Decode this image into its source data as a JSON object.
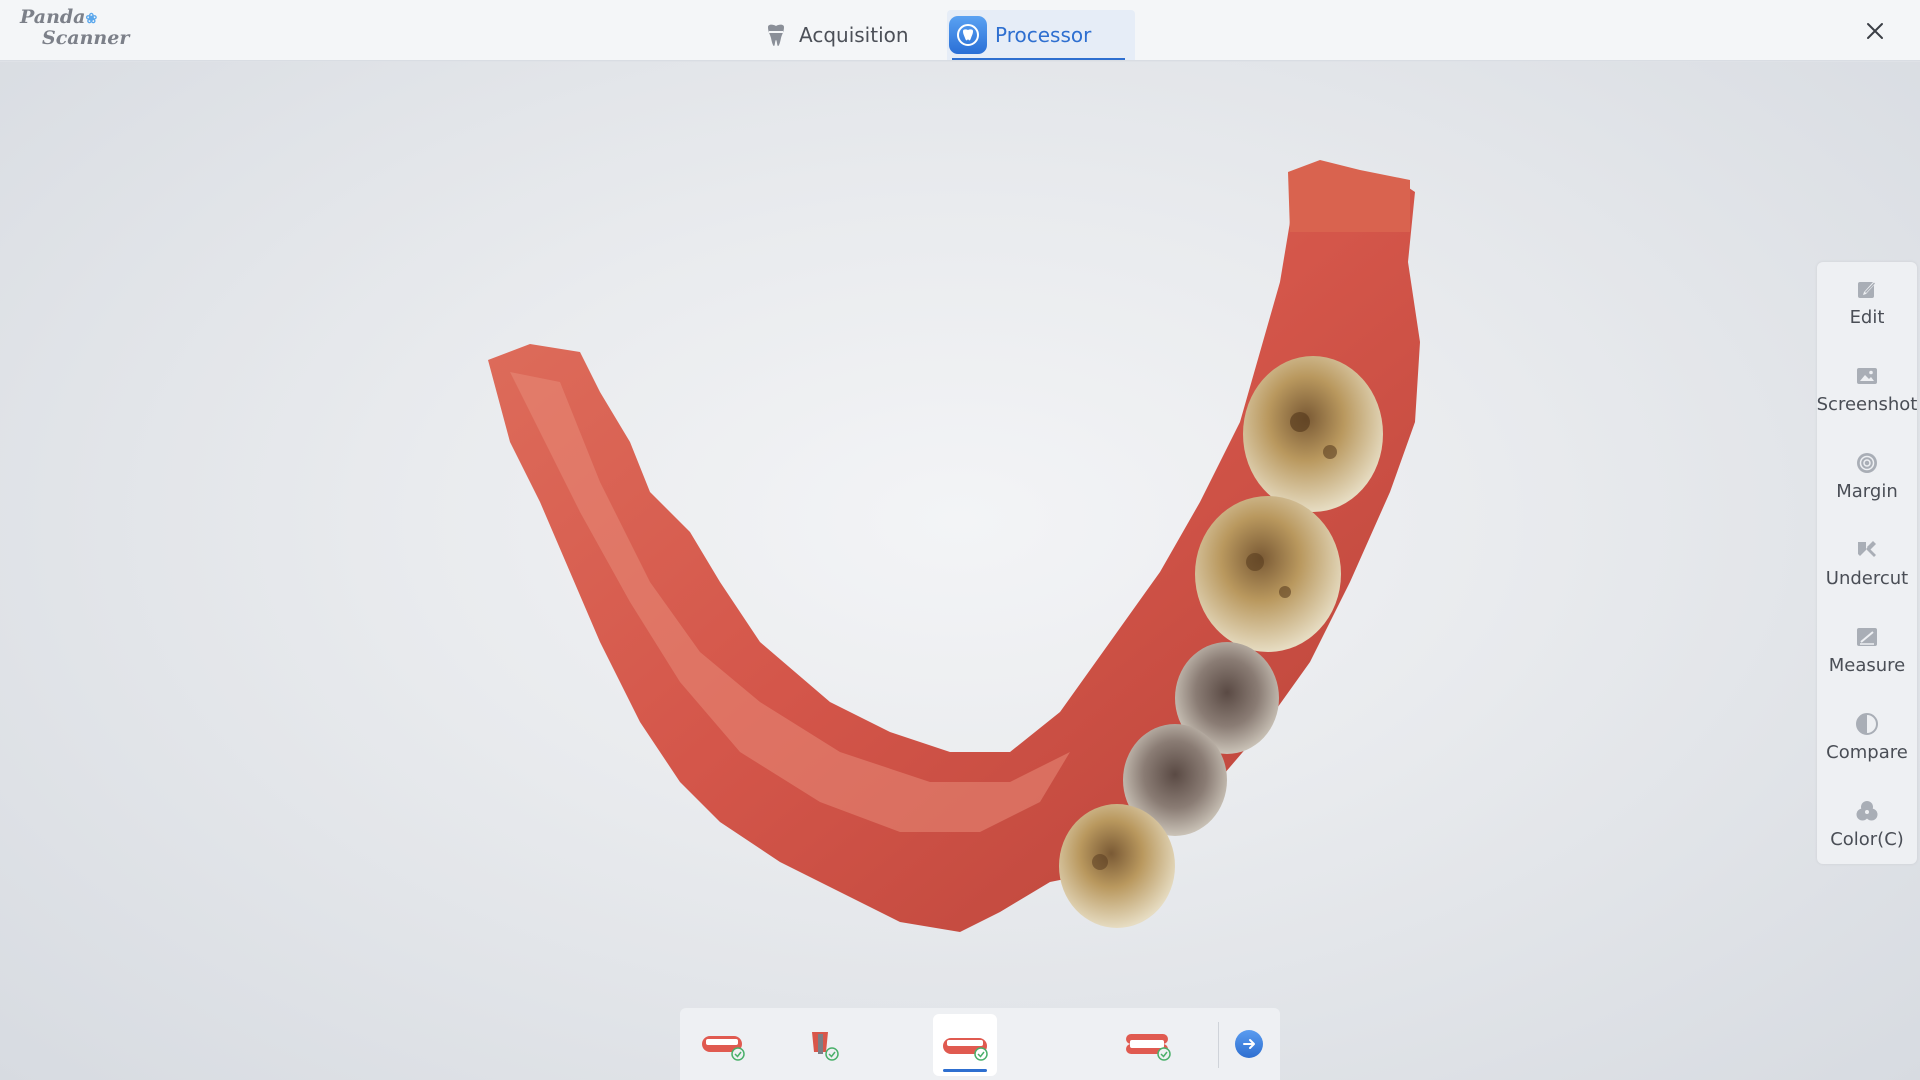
{
  "app": {
    "logo_line1": "Panda",
    "logo_line2": "Scanner"
  },
  "tabs": [
    {
      "label": "Acquisition",
      "icon": "tooth-icon",
      "active": false
    },
    {
      "label": "Processor",
      "icon": "processor-icon",
      "active": true
    }
  ],
  "tools": [
    {
      "label": "Edit",
      "icon": "edit-icon"
    },
    {
      "label": "Screenshot",
      "icon": "screenshot-icon"
    },
    {
      "label": "Margin",
      "icon": "margin-icon"
    },
    {
      "label": "Undercut",
      "icon": "undercut-icon"
    },
    {
      "label": "Measure",
      "icon": "measure-icon"
    },
    {
      "label": "Compare",
      "icon": "compare-icon"
    },
    {
      "label": "Color(C)",
      "icon": "color-icon"
    }
  ],
  "bottom_bar": {
    "items": [
      {
        "icon": "upper-jaw-icon",
        "active": false,
        "checked": true
      },
      {
        "icon": "prep-tooth-icon",
        "active": false,
        "checked": true
      },
      {
        "icon": "lower-jaw-icon",
        "active": true,
        "checked": true
      },
      {
        "icon": "bite-icon",
        "active": false,
        "checked": true
      }
    ],
    "next_icon": "arrow-right-icon"
  },
  "colors": {
    "accent": "#2e6fd0",
    "gum": "#d9564a",
    "tooth": "#d8c8a0"
  }
}
